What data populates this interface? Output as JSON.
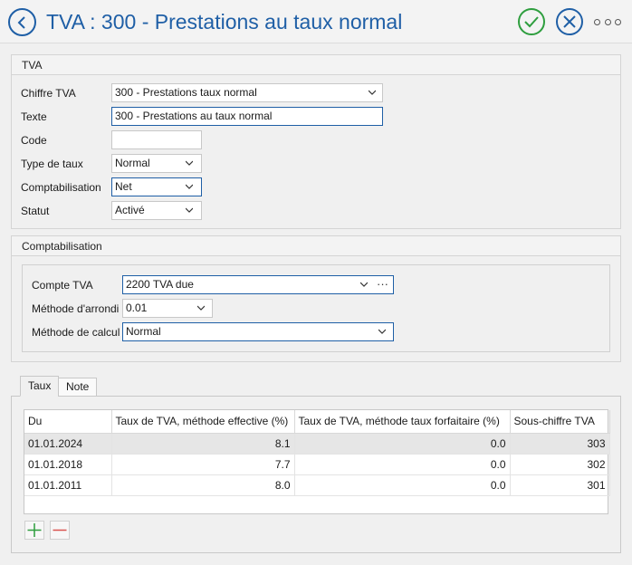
{
  "header": {
    "title": "TVA : 300 - Prestations au taux normal",
    "icons": {
      "back": "back-arrow-icon",
      "ok": "check-icon",
      "cancel": "close-icon",
      "more": "more-icon"
    },
    "colors": {
      "accent": "#1f5fa6",
      "ok": "#2e9e3e"
    }
  },
  "tva_section": {
    "title": "TVA",
    "fields": {
      "chiffre": {
        "label": "Chiffre TVA",
        "value": "300 - Prestations taux normal"
      },
      "texte": {
        "label": "Texte",
        "value": "300 - Prestations au taux normal"
      },
      "code": {
        "label": "Code",
        "value": ""
      },
      "type_taux": {
        "label": "Type de taux",
        "value": "Normal"
      },
      "comptabilisation": {
        "label": "Comptabilisation",
        "value": "Net"
      },
      "statut": {
        "label": "Statut",
        "value": "Activé"
      }
    }
  },
  "compta_section": {
    "title": "Comptabilisation",
    "fields": {
      "compte": {
        "label": "Compte TVA",
        "value": "2200 TVA due",
        "more": "···"
      },
      "arrondi": {
        "label": "Méthode d'arrondi",
        "value": "0.01"
      },
      "calcul": {
        "label": "Méthode de calcul",
        "value": "Normal"
      }
    }
  },
  "tabs": [
    {
      "label": "Taux",
      "active": true
    },
    {
      "label": "Note",
      "active": false
    }
  ],
  "rates_table": {
    "columns": [
      "Du",
      "Taux de TVA, méthode effective (%)",
      "Taux de TVA, méthode taux forfaitaire (%)",
      "Sous-chiffre TVA"
    ],
    "rows": [
      [
        "01.01.2024",
        "8.1",
        "0.0",
        "303"
      ],
      [
        "01.01.2018",
        "7.7",
        "0.0",
        "302"
      ],
      [
        "01.01.2011",
        "8.0",
        "0.0",
        "301"
      ]
    ],
    "selected_row": 0
  },
  "table_actions": {
    "add_icon": "plus-icon",
    "remove_icon": "minus-icon",
    "colors": {
      "add": "#2e9e3e",
      "remove": "#d9534f"
    }
  }
}
